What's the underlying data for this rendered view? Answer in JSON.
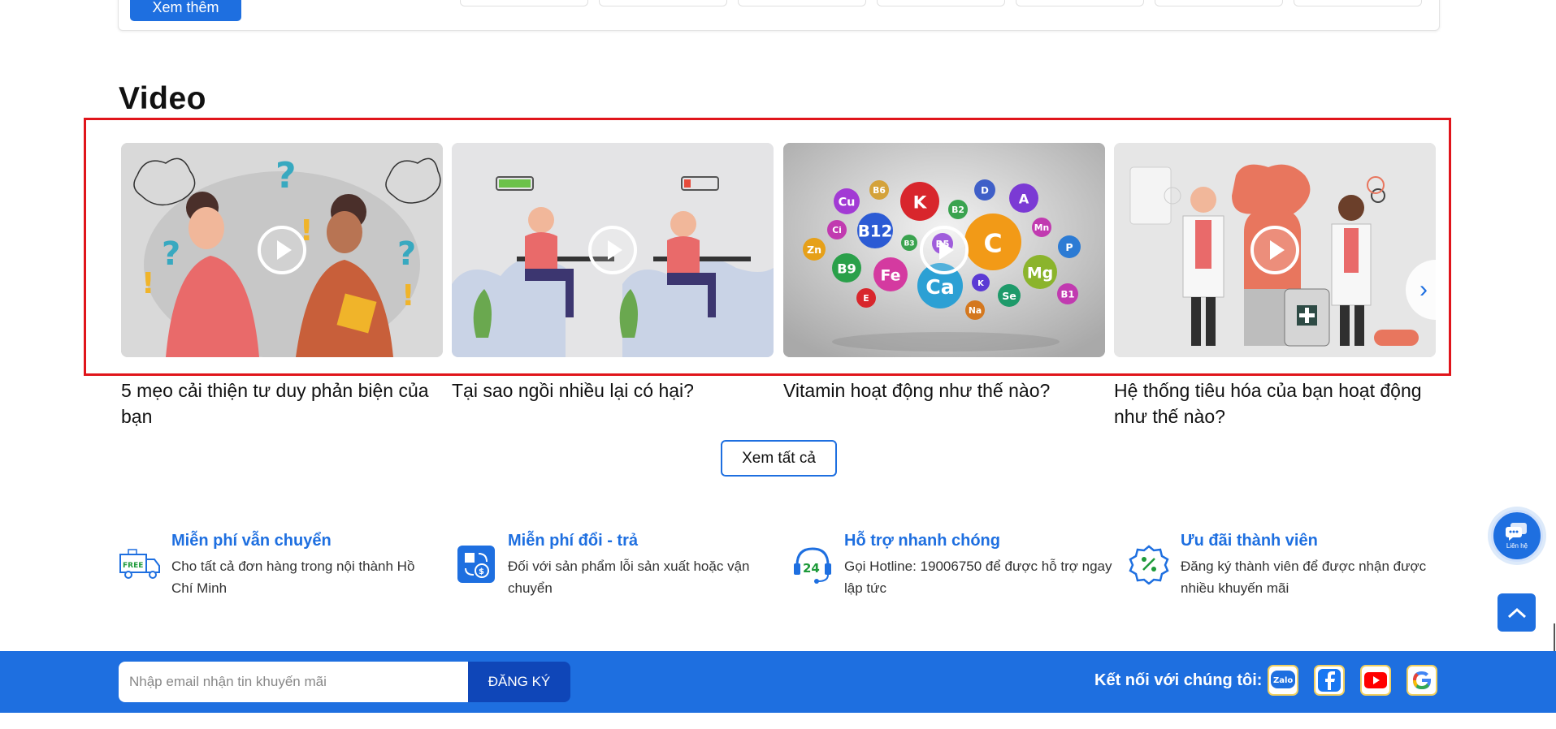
{
  "top_card": {
    "more_label": "Xem thêm"
  },
  "section": {
    "title": "Video"
  },
  "videos": [
    {
      "title": "5 mẹo cải thiện tư duy phản biện của bạn"
    },
    {
      "title": "Tại sao ngồi nhiều lại có hại?"
    },
    {
      "title": "Vitamin hoạt động như thế nào?"
    },
    {
      "title": "Hệ thống tiêu hóa của bạn hoạt động như thế nào?"
    }
  ],
  "vitamin_labels": [
    "B6",
    "D",
    "Cu",
    "K",
    "A",
    "B2",
    "Ci",
    "B12",
    "C",
    "Mn",
    "Zn",
    "B5",
    "B3",
    "P",
    "B9",
    "Fe",
    "Ca",
    "Mg",
    "K",
    "Se",
    "E",
    "Na",
    "B1"
  ],
  "see_all_label": "Xem tất cả",
  "features": [
    {
      "title": "Miễn phí vẫn chuyển",
      "desc": "Cho tất cả đơn hàng trong nội thành Hồ Chí Minh",
      "icon": "free-delivery-truck-icon",
      "badge": "FREE"
    },
    {
      "title": "Miễn phí đổi - trả",
      "desc": "Đối với sản phẩm lỗi sản xuất hoặc vận chuyển",
      "icon": "exchange-return-icon"
    },
    {
      "title": "Hỗ trợ nhanh chóng",
      "desc": "Gọi Hotline: 19006750 để được hỗ trợ ngay lập tức",
      "icon": "support-24-icon",
      "badge": "24"
    },
    {
      "title": "Ưu đãi thành viên",
      "desc": "Đăng ký thành viên để được nhận được nhiều khuyến mãi",
      "icon": "member-discount-icon"
    }
  ],
  "chat_float": {
    "label": "Liên hệ"
  },
  "newsletter": {
    "placeholder": "Nhập email nhận tin khuyến mãi",
    "button": "ĐĂNG KÝ"
  },
  "social": {
    "label": "Kết nối với chúng tôi:",
    "zalo": "Zalo",
    "google": "G"
  },
  "colors": {
    "brand": "#1e6fe0",
    "brand_dark": "#0f46b8",
    "highlight": "#e0151b"
  }
}
